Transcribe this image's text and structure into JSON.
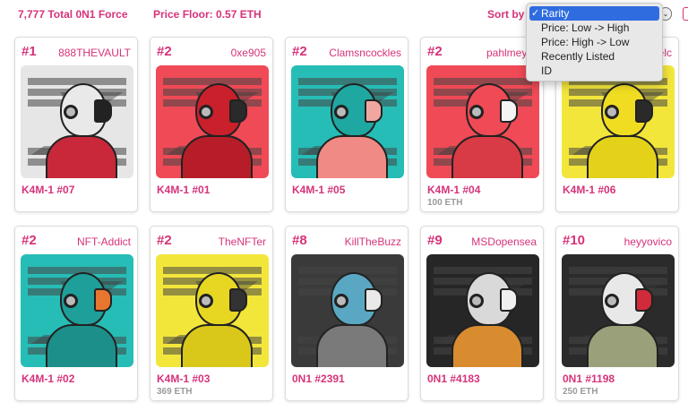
{
  "header": {
    "total_label": "7,777 Total 0N1 Force",
    "floor_label": "Price Floor: 0.57 ETH",
    "sort_label": "Sort by"
  },
  "sort_menu": {
    "selected": "Rarity",
    "options": [
      "Rarity",
      "Price: Low -> High",
      "Price: High -> Low",
      "Recently Listed",
      "ID"
    ]
  },
  "colors": {
    "accent": "#d6337a",
    "menu_highlight": "#2f6ce0"
  },
  "cards": [
    {
      "rank": "#1",
      "owner": "888THEVAULT",
      "name": "K4M-1 #07",
      "price": "",
      "palette": {
        "bg": "#e6e6e6",
        "helmet": "#e9e9e9",
        "face": "#222222",
        "body": "#c8283a"
      }
    },
    {
      "rank": "#2",
      "owner": "0xe905",
      "name": "K4M-1 #01",
      "price": "",
      "palette": {
        "bg": "#ef4a56",
        "helmet": "#c9202c",
        "face": "#2a2a2a",
        "body": "#b71d28"
      }
    },
    {
      "rank": "#2",
      "owner": "Clamsncockles",
      "name": "K4M-1 #05",
      "price": "",
      "palette": {
        "bg": "#26bdb6",
        "helmet": "#1fa7a1",
        "face": "#f0a7a0",
        "body": "#f08a84"
      }
    },
    {
      "rank": "#2",
      "owner": "pahlmeyer",
      "name": "K4M-1 #04",
      "price": "100 ETH",
      "palette": {
        "bg": "#ef4a56",
        "helmet": "#ef4a56",
        "face": "#f4f4f4",
        "body": "#d83a46"
      }
    },
    {
      "rank": "#2",
      "owner": "elc",
      "name": "K4M-1 #06",
      "price": "",
      "palette": {
        "bg": "#f3e63b",
        "helmet": "#f0dd22",
        "face": "#2a2a2a",
        "body": "#e4d21a"
      }
    },
    {
      "rank": "#2",
      "owner": "NFT-Addict",
      "name": "K4M-1 #02",
      "price": "",
      "palette": {
        "bg": "#26bdb6",
        "helmet": "#1f9f9a",
        "face": "#e7762f",
        "body": "#1c8f8a"
      }
    },
    {
      "rank": "#2",
      "owner": "TheNFTer",
      "name": "K4M-1 #03",
      "price": "369 ETH",
      "palette": {
        "bg": "#f3e63b",
        "helmet": "#e8d722",
        "face": "#333333",
        "body": "#d9c81a"
      }
    },
    {
      "rank": "#8",
      "owner": "KillTheBuzz",
      "name": "0N1 #2391",
      "price": "",
      "palette": {
        "bg": "#3a3a3a",
        "helmet": "#5aa7c4",
        "face": "#e9e9e9",
        "body": "#7a7a7a"
      }
    },
    {
      "rank": "#9",
      "owner": "MSDopensea",
      "name": "0N1 #4183",
      "price": "",
      "palette": {
        "bg": "#262626",
        "helmet": "#d9d9d9",
        "face": "#f0f0f0",
        "body": "#d98b2f"
      }
    },
    {
      "rank": "#10",
      "owner": "heyyovico",
      "name": "0N1 #1198",
      "price": "250 ETH",
      "palette": {
        "bg": "#2b2b2b",
        "helmet": "#e8e8e8",
        "face": "#d12a3a",
        "body": "#9aa07a"
      }
    }
  ]
}
